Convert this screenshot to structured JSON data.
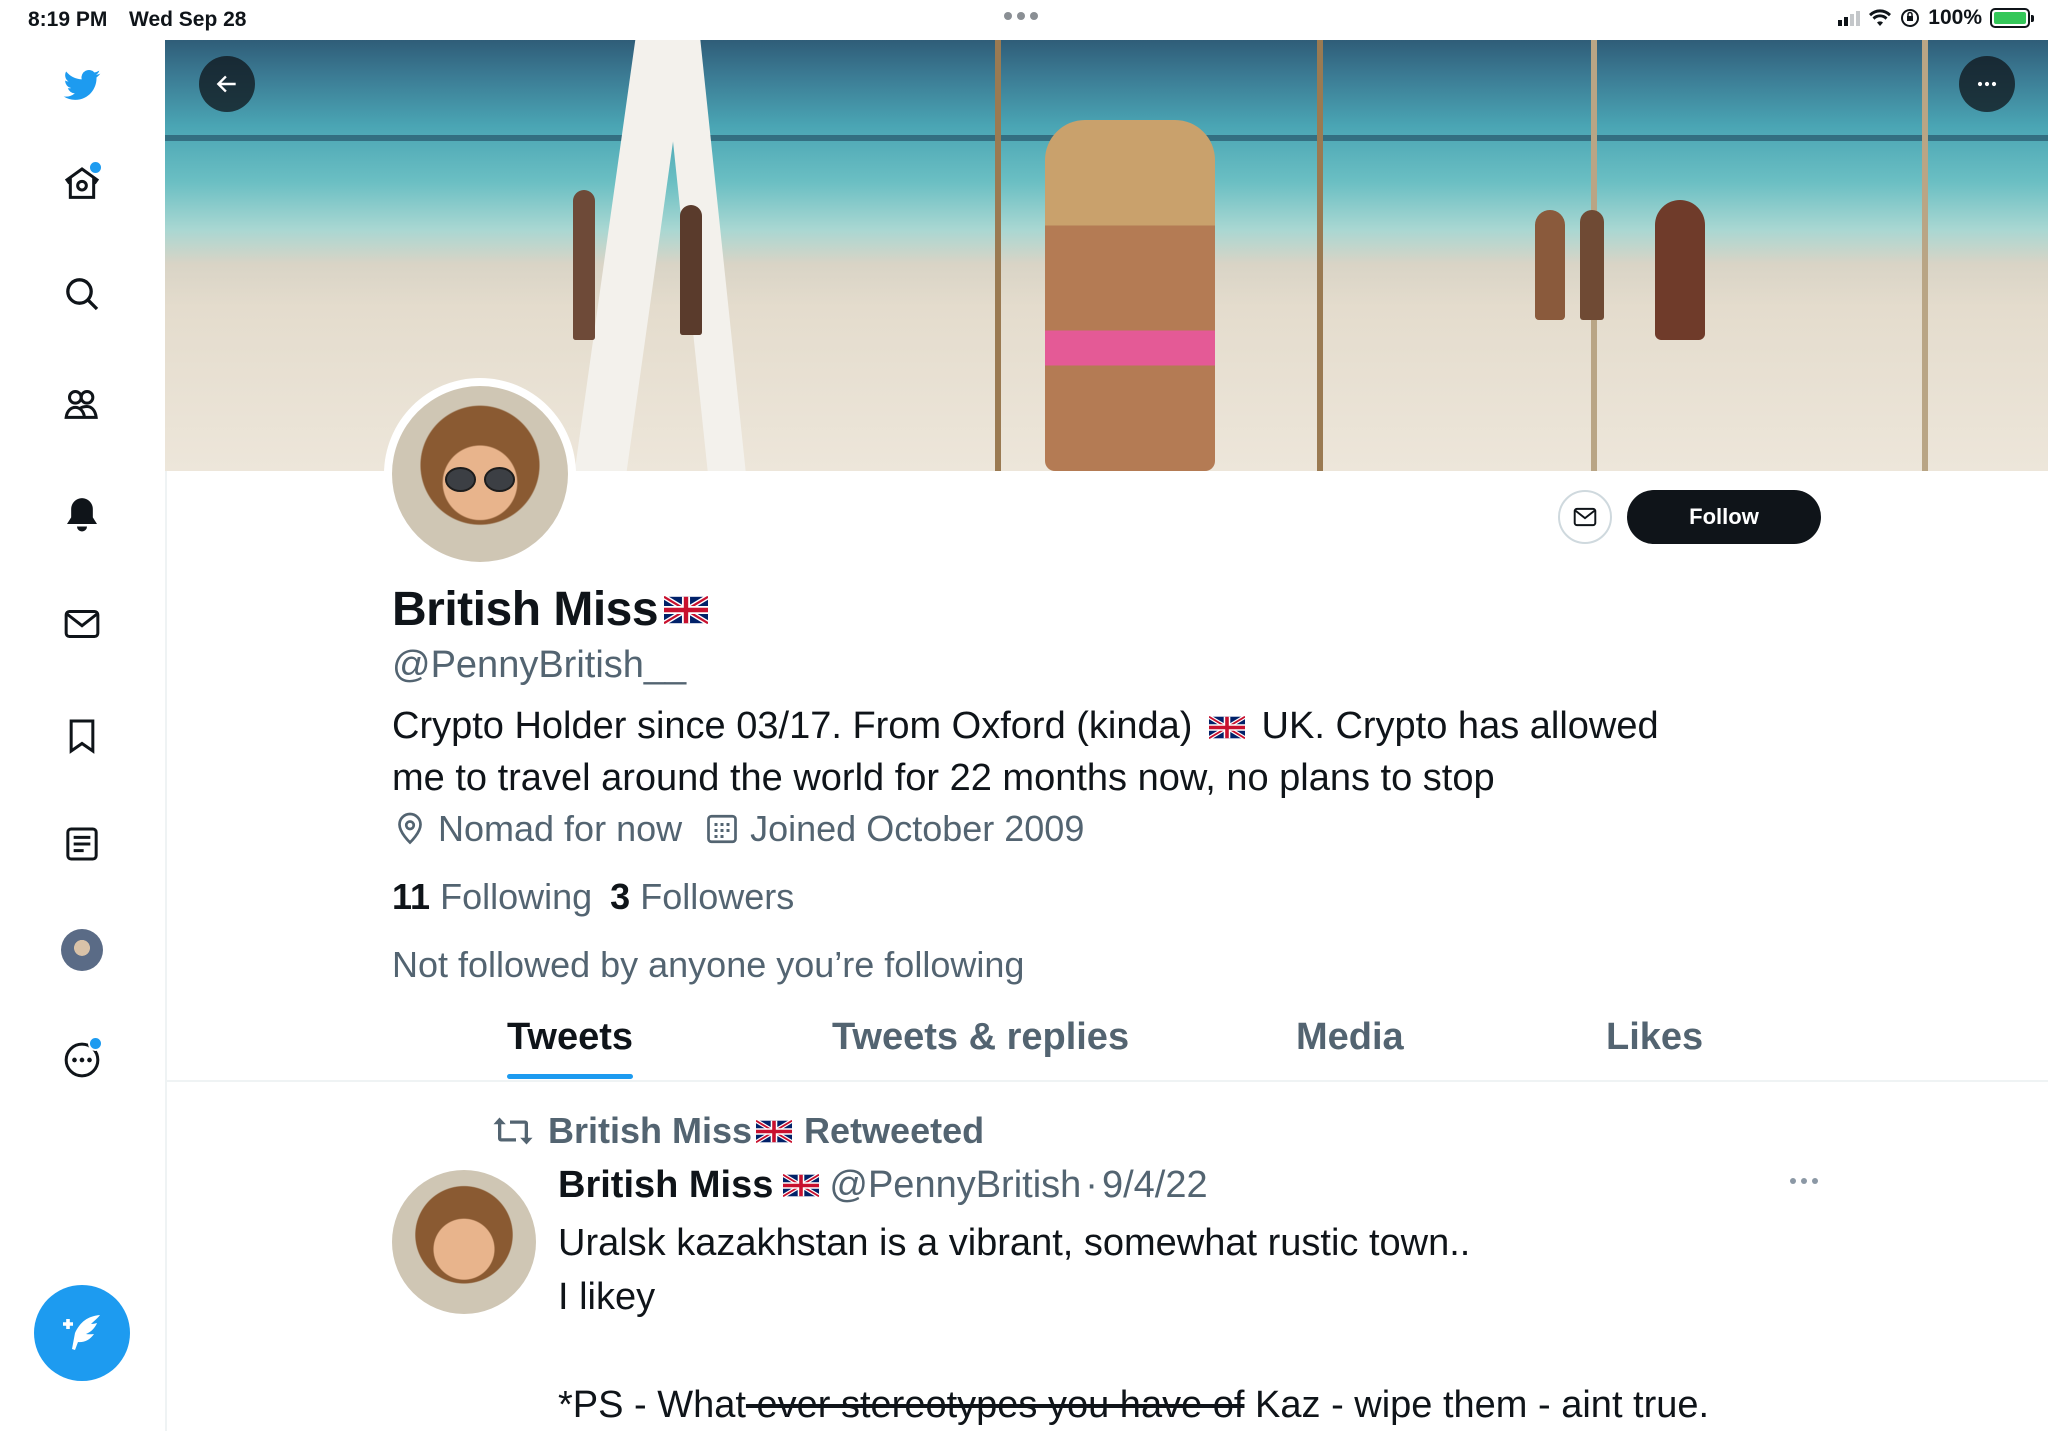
{
  "status_bar": {
    "time": "8:19 PM",
    "date": "Wed Sep 28",
    "battery": "100%"
  },
  "colors": {
    "accent": "#1d9bf0",
    "text_primary": "#0f1419",
    "text_secondary": "#536471"
  },
  "sidebar": {
    "items": [
      {
        "name": "twitter-logo",
        "icon": "bird-icon"
      },
      {
        "name": "home",
        "icon": "home-icon",
        "badge": true
      },
      {
        "name": "explore",
        "icon": "search-icon"
      },
      {
        "name": "communities",
        "icon": "communities-icon"
      },
      {
        "name": "notifications",
        "icon": "bell-icon"
      },
      {
        "name": "messages",
        "icon": "envelope-icon"
      },
      {
        "name": "bookmarks",
        "icon": "bookmark-icon"
      },
      {
        "name": "lists",
        "icon": "list-icon"
      },
      {
        "name": "profile",
        "icon": "avatar"
      },
      {
        "name": "more",
        "icon": "more-circle-icon",
        "badge": true
      }
    ],
    "compose_icon": "compose-feather-icon"
  },
  "profile": {
    "name": "British Miss",
    "handle": "@PennyBritish__",
    "bio_line1_a": "Crypto Holder since 03/17. From Oxford (kinda)",
    "bio_line1_b": "UK. Crypto has allowed",
    "bio_line2": "me to travel around the world for 22 months now, no plans to stop",
    "location": "Nomad for now",
    "joined": "Joined October 2009",
    "following_count": "11",
    "following_label": "Following",
    "followers_count": "3",
    "followers_label": "Followers",
    "not_followed": "Not followed by anyone you’re following",
    "follow_label": "Follow"
  },
  "tabs": [
    "Tweets",
    "Tweets & replies",
    "Media",
    "Likes"
  ],
  "active_tab": "Tweets",
  "tweet": {
    "retweeted_name": "British Miss",
    "retweeted_label": "Retweeted",
    "author_name": "British Miss",
    "author_handle": "@PennyBritish",
    "separator": "·",
    "date": "9/4/22",
    "line1": "Uralsk kazakhstan is a vibrant, somewhat rustic town..",
    "line2": "I likey",
    "line3_a": "*PS - What",
    "line3_struck": " ever stereotypes you have of",
    "line3_b": " Kaz - wipe them - aint true."
  }
}
